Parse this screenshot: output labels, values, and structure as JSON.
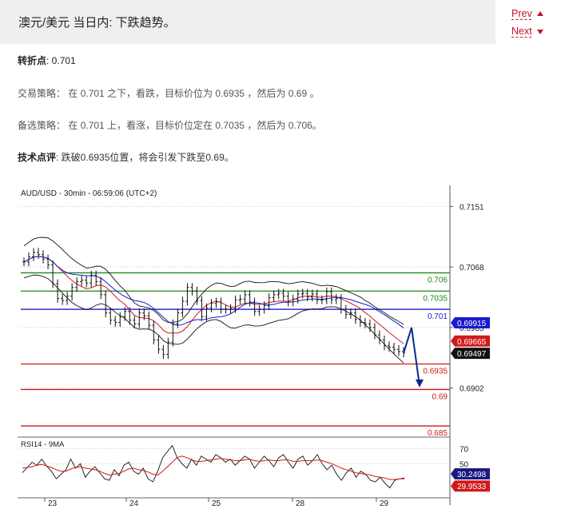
{
  "header": {
    "title": "澳元/美元 当日内: 下跌趋势。"
  },
  "pager": {
    "prev": "Prev",
    "next": "Next"
  },
  "analysis": {
    "pivot_label": "转折点",
    "pivot_value": ": 0.701",
    "strategy_label": "交易策略：",
    "strategy_text": "在 0.701 之下，看跌，目标价位为 0.6935 ，然后为 0.69 。",
    "alt_label": "备选策略：",
    "alt_text": "在 0.701 上，看涨，目标价位定在 0.7035 ，然后为 0.706。",
    "comment_label": "技术点评",
    "comment_text": ": 跌破0.6935位置，将会引发下跌至0.69。"
  },
  "chart_data": {
    "type": "line",
    "title": "AUD/USD - 30min - 06:59:06 (UTC+2)",
    "x_labels": [
      "23",
      "24",
      "25",
      "28",
      "29"
    ],
    "y_ticks": [
      0.7151,
      0.7068,
      0.6985,
      0.6902
    ],
    "y_tick_labels": [
      "0.7151",
      "0.7068",
      "0.6985",
      "0.6902"
    ],
    "ylim": [
      0.6838,
      0.7169
    ],
    "levels": [
      {
        "value": 0.706,
        "label": "0.706",
        "color": "#1a8a1a"
      },
      {
        "value": 0.7035,
        "label": "0.7035",
        "color": "#1a8a1a"
      },
      {
        "value": 0.701,
        "label": "0.701",
        "color": "#1a1ad0"
      },
      {
        "value": 0.6935,
        "label": "0.6935",
        "color": "#d01a1a"
      },
      {
        "value": 0.69,
        "label": "0.69",
        "color": "#d01a1a"
      },
      {
        "value": 0.685,
        "label": "0.685",
        "color": "#d01a1a"
      }
    ],
    "price_tags": [
      {
        "value": 0.69915,
        "label": "0.69915",
        "color": "#1a1ad0"
      },
      {
        "value": 0.69665,
        "label": "0.69665",
        "color": "#d01a1a"
      },
      {
        "value": 0.69497,
        "label": "0.69497",
        "color": "#111111"
      }
    ],
    "price_series": [
      0.7075,
      0.7082,
      0.7088,
      0.7085,
      0.7079,
      0.7071,
      0.7045,
      0.7025,
      0.7022,
      0.7028,
      0.704,
      0.7048,
      0.705,
      0.7046,
      0.7057,
      0.7048,
      0.703,
      0.7005,
      0.6995,
      0.6992,
      0.7,
      0.7007,
      0.6995,
      0.699,
      0.7005,
      0.7001,
      0.6988,
      0.6968,
      0.6955,
      0.6948,
      0.6965,
      0.699,
      0.7005,
      0.7021,
      0.704,
      0.7035,
      0.7022,
      0.7,
      0.7012,
      0.7018,
      0.702,
      0.701,
      0.701,
      0.7011,
      0.7023,
      0.7024,
      0.703,
      0.702,
      0.7007,
      0.701,
      0.7015,
      0.7026,
      0.703,
      0.7032,
      0.7028,
      0.702,
      0.7024,
      0.7031,
      0.7032,
      0.7027,
      0.7031,
      0.7023,
      0.7023,
      0.7034,
      0.7023,
      0.7025,
      0.701,
      0.7003,
      0.7005,
      0.6996,
      0.6992,
      0.699,
      0.6985,
      0.6975,
      0.6968,
      0.696,
      0.6958,
      0.6955,
      0.6952,
      0.695
    ],
    "forecast_path": [
      0.695,
      0.6985,
      0.6905
    ],
    "rsi": {
      "label": "RSI14 - 9MA",
      "ylim": [
        8,
        82
      ],
      "y_ticks": [
        70,
        50
      ],
      "value_tags": [
        {
          "value": 30.2498,
          "label": "30.2498",
          "color": "#1a1a80"
        },
        {
          "value": 29.9533,
          "label": "29.9533",
          "color": "#d01a1a"
        }
      ],
      "rsi_series": [
        38,
        45,
        52,
        48,
        56,
        47,
        40,
        30,
        36,
        42,
        56,
        44,
        50,
        32,
        40,
        46,
        38,
        30,
        28,
        42,
        34,
        48,
        52,
        40,
        36,
        44,
        30,
        26,
        40,
        58,
        66,
        74,
        58,
        50,
        44,
        56,
        48,
        60,
        56,
        52,
        62,
        58,
        52,
        56,
        48,
        54,
        60,
        56,
        44,
        52,
        60,
        54,
        46,
        58,
        62,
        52,
        44,
        56,
        60,
        48,
        54,
        62,
        50,
        42,
        48,
        36,
        28,
        38,
        44,
        32,
        40,
        36,
        28,
        26,
        32,
        24,
        18,
        28,
        30,
        31
      ],
      "ma_series": [
        44,
        45,
        46,
        48,
        49,
        47,
        45,
        42,
        40,
        40,
        43,
        45,
        46,
        44,
        43,
        42,
        40,
        37,
        35,
        36,
        37,
        40,
        43,
        44,
        42,
        41,
        39,
        36,
        35,
        40,
        46,
        52,
        58,
        60,
        58,
        55,
        53,
        53,
        54,
        55,
        56,
        57,
        56,
        55,
        54,
        54,
        55,
        56,
        54,
        53,
        54,
        55,
        54,
        54,
        55,
        55,
        53,
        53,
        54,
        54,
        54,
        55,
        54,
        52,
        50,
        47,
        44,
        42,
        40,
        38,
        37,
        36,
        35,
        33,
        32,
        31,
        29,
        29,
        30,
        30
      ]
    }
  }
}
